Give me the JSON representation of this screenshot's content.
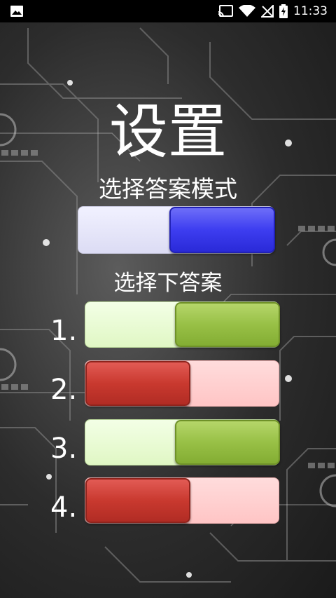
{
  "status_bar": {
    "time": "11:33",
    "left_icon": "image-icon",
    "right_icons": [
      "cast-icon",
      "wifi-icon",
      "no-signal-icon",
      "battery-charging-icon"
    ]
  },
  "page": {
    "title": "设置",
    "mode_label": "选择答案模式",
    "answer_label": "选择下答案"
  },
  "mode_toggle": {
    "state": "on",
    "knob_color": "#3d3df0"
  },
  "answers": [
    {
      "number": "1.",
      "state": "on",
      "knob_color": "#98c046"
    },
    {
      "number": "2.",
      "state": "off",
      "knob_color": "#c9392f"
    },
    {
      "number": "3.",
      "state": "on",
      "knob_color": "#98c046"
    },
    {
      "number": "4.",
      "state": "off",
      "knob_color": "#c9392f"
    }
  ]
}
